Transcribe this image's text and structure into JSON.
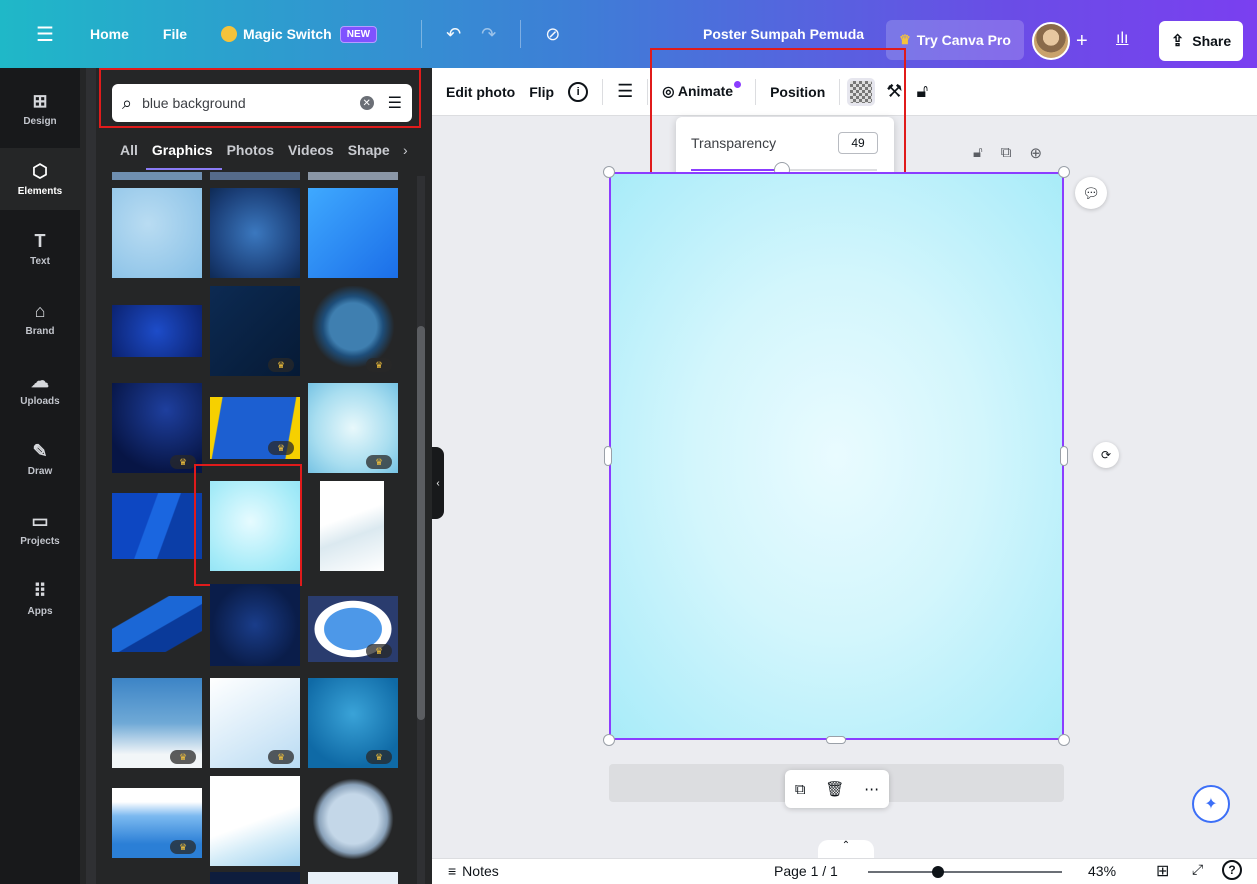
{
  "topbar": {
    "home": "Home",
    "file": "File",
    "magic_switch": "Magic Switch",
    "new_badge": "NEW",
    "doc_title": "Poster Sumpah Pemuda",
    "try_pro": "Try Canva Pro",
    "share": "Share"
  },
  "rail": [
    {
      "label": "Design",
      "icon": "layout-icon"
    },
    {
      "label": "Elements",
      "icon": "shapes-icon"
    },
    {
      "label": "Text",
      "icon": "text-icon"
    },
    {
      "label": "Brand",
      "icon": "brand-icon"
    },
    {
      "label": "Uploads",
      "icon": "upload-icon"
    },
    {
      "label": "Draw",
      "icon": "draw-icon"
    },
    {
      "label": "Projects",
      "icon": "folder-icon"
    },
    {
      "label": "Apps",
      "icon": "apps-icon"
    }
  ],
  "search": {
    "value": "blue background"
  },
  "tabs": [
    "All",
    "Graphics",
    "Photos",
    "Videos",
    "Shape"
  ],
  "context": {
    "edit_photo": "Edit photo",
    "flip": "Flip",
    "animate": "Animate",
    "position": "Position"
  },
  "transparency": {
    "label": "Transparency",
    "value": "49"
  },
  "bottom": {
    "notes": "Notes",
    "page": "Page 1 / 1",
    "zoom": "43%"
  },
  "colors": {
    "accent": "#8b3dff",
    "highlight": "#e01b1b"
  }
}
